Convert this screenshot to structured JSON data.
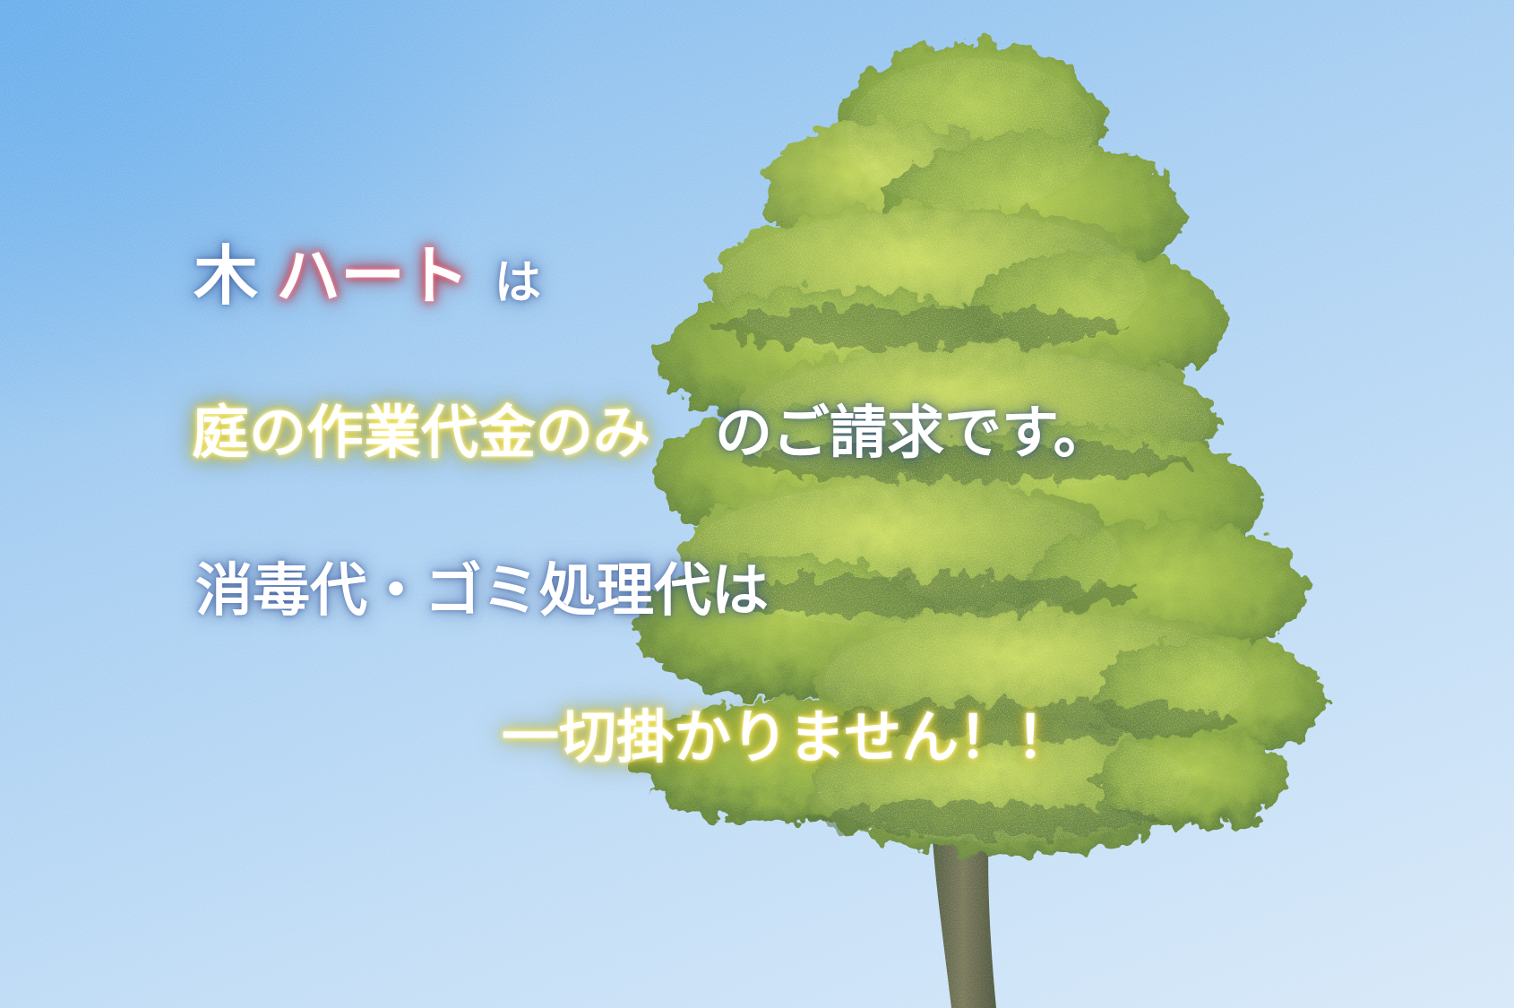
{
  "headline": {
    "part1": "木",
    "part2": "ハート",
    "part3": "は"
  },
  "line2": {
    "highlight": "庭の作業代金のみ",
    "rest": "のご請求です。"
  },
  "line3": {
    "text": "消毒代・ゴミ処理代は"
  },
  "line4": {
    "text": "一切掛かりません！！"
  },
  "colors": {
    "sky_top": "#5aa6ea",
    "sky_bottom": "#d3e6f8",
    "foliage": "#6f9a2a",
    "highlight_glow": "#f2e04a",
    "brand_glow": "#e0404e"
  }
}
